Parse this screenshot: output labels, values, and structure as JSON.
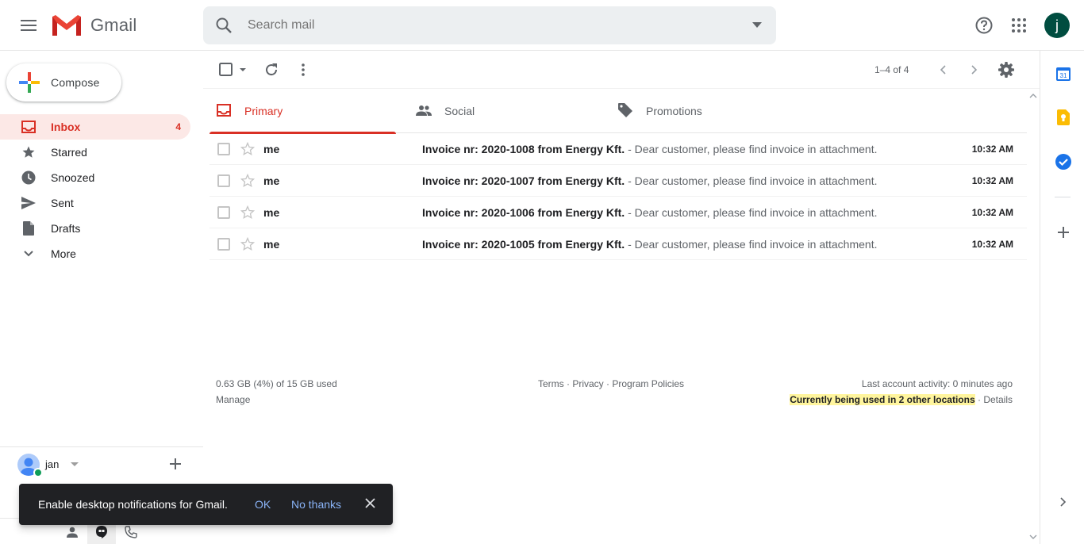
{
  "app": {
    "name": "Gmail"
  },
  "search": {
    "placeholder": "Search mail"
  },
  "user": {
    "initial": "j",
    "name": "jan"
  },
  "compose": {
    "label": "Compose"
  },
  "sidebar": {
    "items": [
      {
        "label": "Inbox",
        "count": "4",
        "icon": "inbox-icon",
        "active": true
      },
      {
        "label": "Starred",
        "count": "",
        "icon": "star-icon"
      },
      {
        "label": "Snoozed",
        "count": "",
        "icon": "clock-icon"
      },
      {
        "label": "Sent",
        "count": "",
        "icon": "send-icon"
      },
      {
        "label": "Drafts",
        "count": "",
        "icon": "draft-icon"
      },
      {
        "label": "More",
        "count": "",
        "icon": "chevron-down-icon"
      }
    ]
  },
  "toolbar": {
    "pager": "1–4 of 4"
  },
  "tabs": [
    {
      "label": "Primary",
      "icon": "inbox-icon",
      "active": true
    },
    {
      "label": "Social",
      "icon": "people-icon"
    },
    {
      "label": "Promotions",
      "icon": "tag-icon"
    }
  ],
  "emails": [
    {
      "sender": "me",
      "subject": "Invoice nr: 2020-1008 from Energy Kft.",
      "snippet": " - Dear customer, please find invoice in attachment.",
      "time": "10:32 AM"
    },
    {
      "sender": "me",
      "subject": "Invoice nr: 2020-1007 from Energy Kft.",
      "snippet": " - Dear customer, please find invoice in attachment.",
      "time": "10:32 AM"
    },
    {
      "sender": "me",
      "subject": "Invoice nr: 2020-1006 from Energy Kft.",
      "snippet": " - Dear customer, please find invoice in attachment.",
      "time": "10:32 AM"
    },
    {
      "sender": "me",
      "subject": "Invoice nr: 2020-1005 from Energy Kft.",
      "snippet": " - Dear customer, please find invoice in attachment.",
      "time": "10:32 AM"
    }
  ],
  "footer": {
    "storage": "0.63 GB (4%) of 15 GB used",
    "manage": "Manage",
    "terms": "Terms",
    "privacy": "Privacy",
    "policies": "Program Policies",
    "sep": " · ",
    "activity": "Last account activity: 0 minutes ago",
    "locations": "Currently being used in 2 other locations",
    "details": "Details"
  },
  "toast": {
    "message": "Enable desktop notifications for Gmail.",
    "ok": "OK",
    "no_thanks": "No thanks"
  },
  "colors": {
    "accent": "#d93025",
    "avatar": "#004d40",
    "link": "#8ab4f8"
  }
}
